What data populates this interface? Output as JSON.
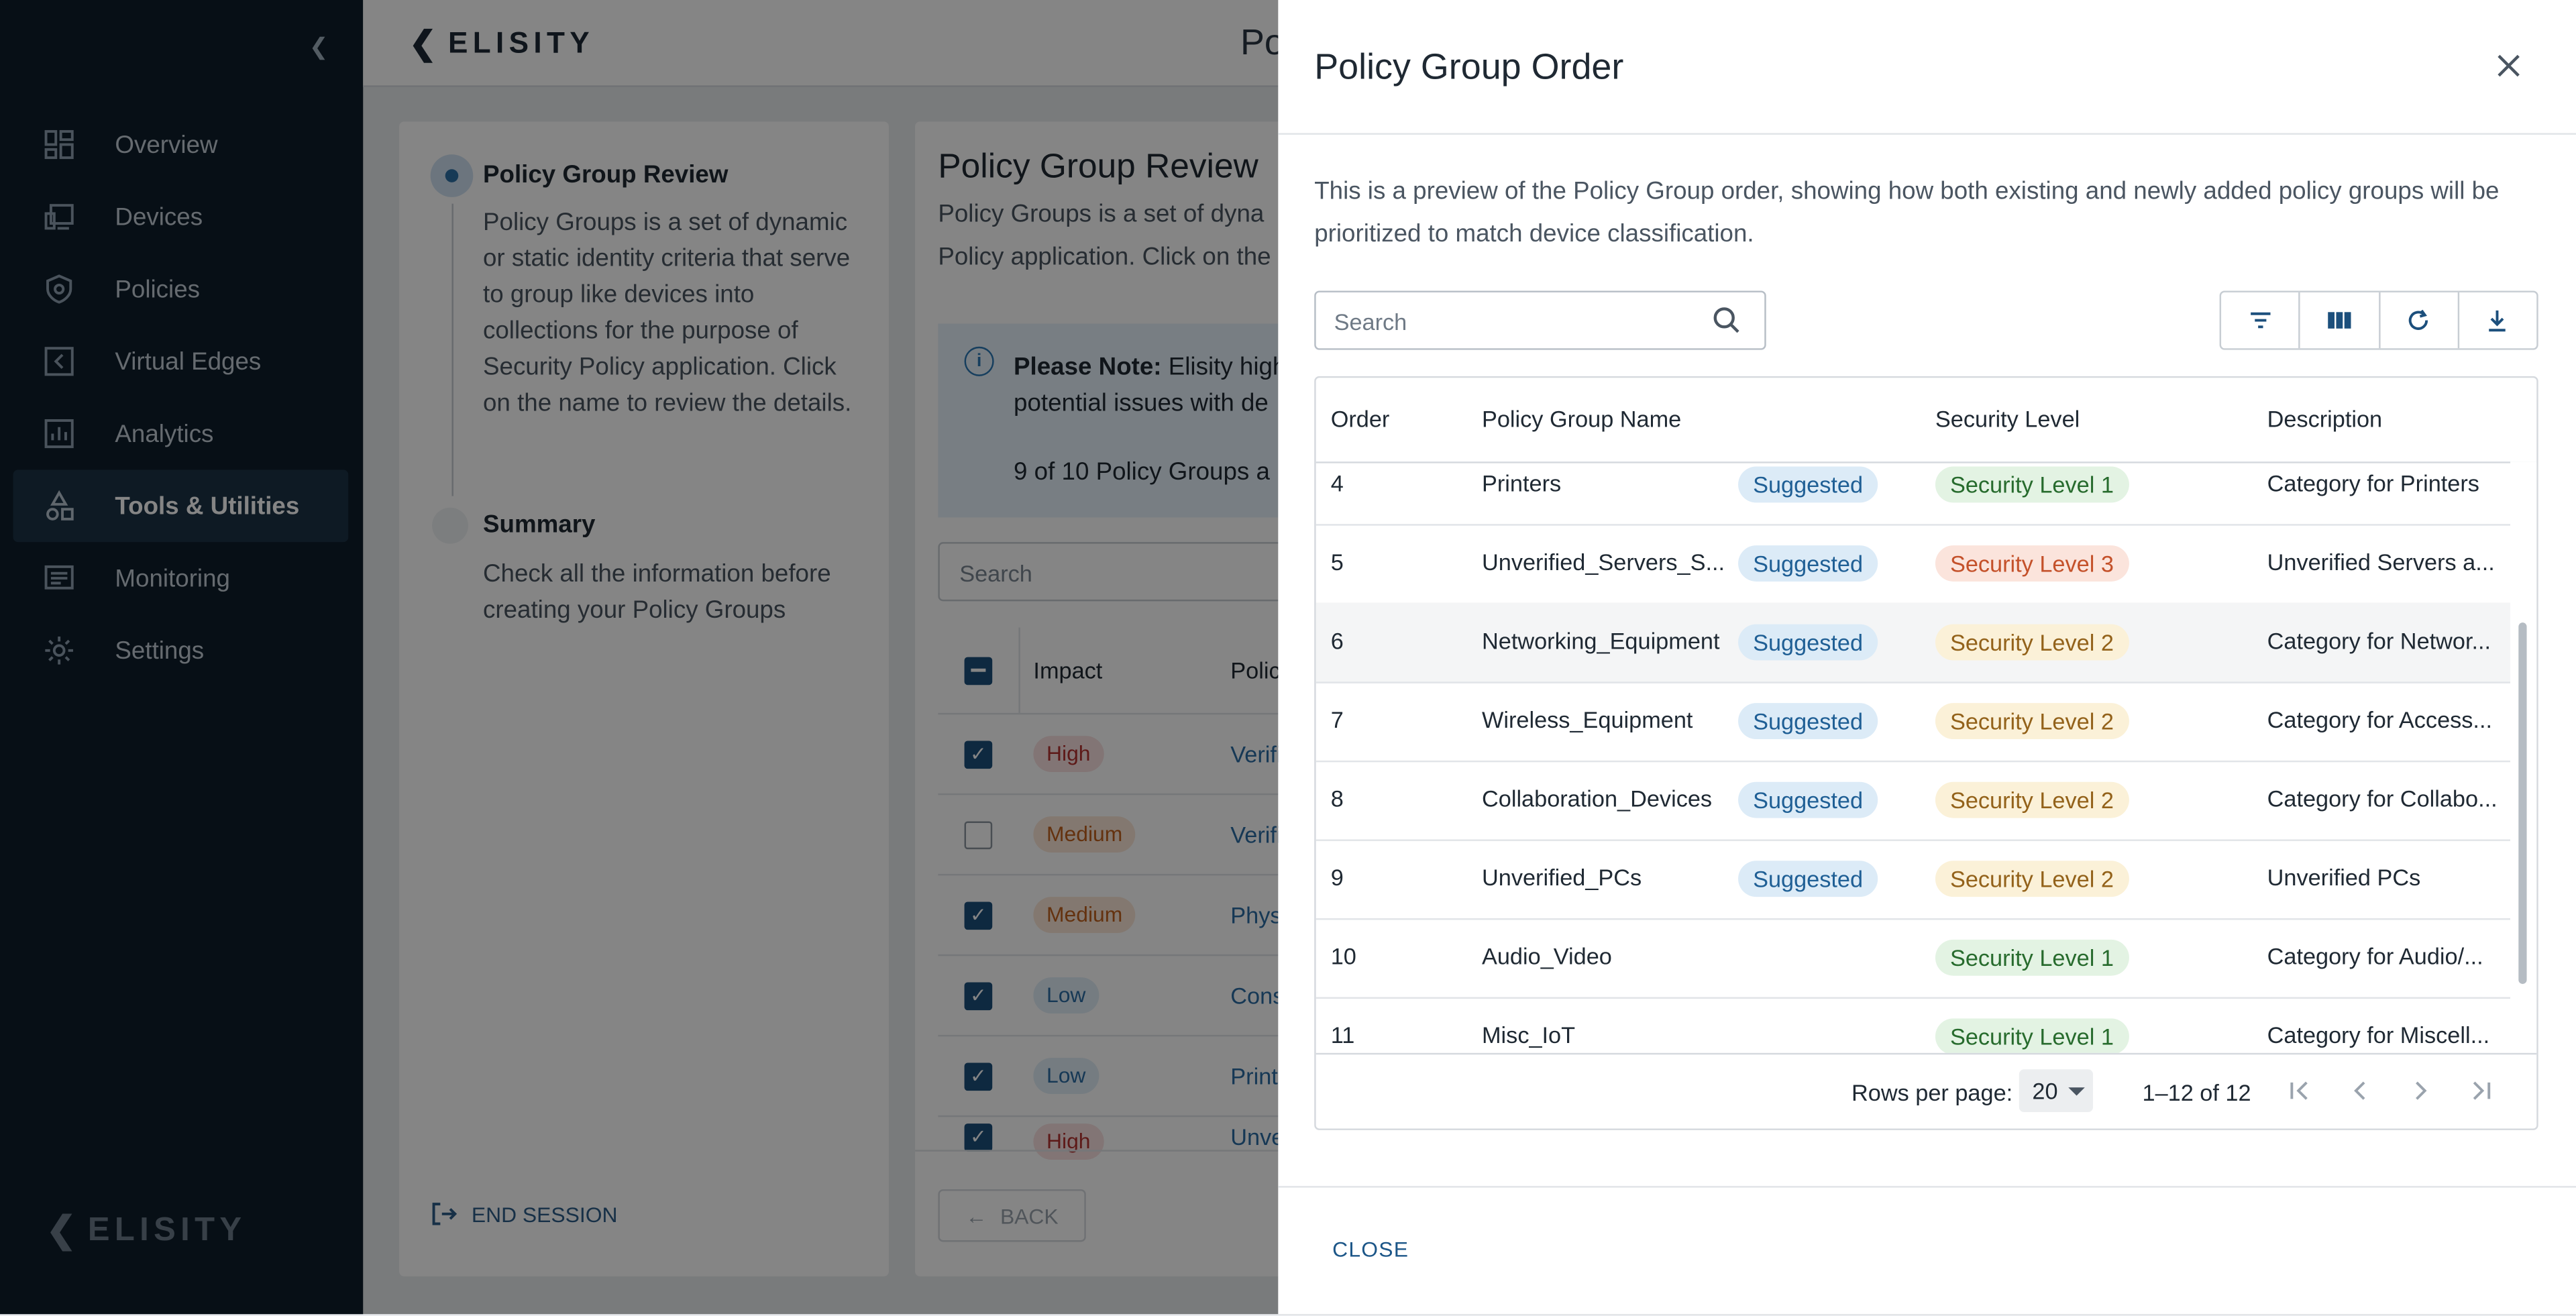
{
  "brand": {
    "name": "ELISITY"
  },
  "sidebar": {
    "items": [
      {
        "label": "Overview",
        "icon": "dashboard-icon"
      },
      {
        "label": "Devices",
        "icon": "devices-icon"
      },
      {
        "label": "Policies",
        "icon": "shield-icon"
      },
      {
        "label": "Virtual Edges",
        "icon": "virtual-edge-icon"
      },
      {
        "label": "Analytics",
        "icon": "analytics-icon"
      },
      {
        "label": "Tools & Utilities",
        "icon": "tools-icon",
        "active": true
      },
      {
        "label": "Monitoring",
        "icon": "monitoring-icon"
      },
      {
        "label": "Settings",
        "icon": "gear-icon"
      }
    ]
  },
  "header": {
    "title": "Po"
  },
  "wizard": {
    "steps": [
      {
        "title": "Policy Group Review",
        "description": "Policy Groups is a set of dynamic or static identity criteria that serve to group like devices into collections for the purpose of Security Policy application. Click on the name to review the details."
      },
      {
        "title": "Summary",
        "description": "Check all the information before creating your Policy Groups"
      }
    ],
    "end_session": "END SESSION"
  },
  "main": {
    "title": "Policy Group Review",
    "description": "Policy Groups is a set of dyna Policy application. Click on the",
    "note": {
      "bold": "Please Note:",
      "text": " Elisity high",
      "text2": "potential issues with de",
      "count": "9 of 10 Policy Groups a"
    },
    "search_placeholder": "Search",
    "table": {
      "headers": [
        "Impact",
        "Polic"
      ],
      "rows": [
        {
          "checked": true,
          "impact": "High",
          "level": "high",
          "name": "Verifi"
        },
        {
          "checked": false,
          "impact": "Medium",
          "level": "medium",
          "name": "Verifi"
        },
        {
          "checked": true,
          "impact": "Medium",
          "level": "medium",
          "name": "Physi"
        },
        {
          "checked": true,
          "impact": "Low",
          "level": "low",
          "name": "Cons"
        },
        {
          "checked": true,
          "impact": "Low",
          "level": "low",
          "name": "Printe"
        },
        {
          "checked": true,
          "impact": "High",
          "level": "high",
          "name": "Unve"
        }
      ]
    },
    "back_label": "BACK"
  },
  "drawer": {
    "title": "Policy Group Order",
    "description": "This is a preview of the Policy Group order, showing how both existing and newly added policy groups will be prioritized to match device classification.",
    "search_placeholder": "Search",
    "columns": [
      "Order",
      "Policy Group Name",
      "Security Level",
      "Description"
    ],
    "rows": [
      {
        "order": "4",
        "name": "Printers",
        "tag": "Suggested",
        "level": "Security Level 1",
        "lvl": 1,
        "description": "Category for Printers"
      },
      {
        "order": "5",
        "name": "Unverified_Servers_S...",
        "tag": "Suggested",
        "level": "Security Level 3",
        "lvl": 3,
        "description": "Unverified Servers a..."
      },
      {
        "order": "6",
        "name": "Networking_Equipment",
        "tag": "Suggested",
        "level": "Security Level 2",
        "lvl": 2,
        "description": "Category for Networ..."
      },
      {
        "order": "7",
        "name": "Wireless_Equipment",
        "tag": "Suggested",
        "level": "Security Level 2",
        "lvl": 2,
        "description": "Category for Access..."
      },
      {
        "order": "8",
        "name": "Collaboration_Devices",
        "tag": "Suggested",
        "level": "Security Level 2",
        "lvl": 2,
        "description": "Category for Collabo..."
      },
      {
        "order": "9",
        "name": "Unverified_PCs",
        "tag": "Suggested",
        "level": "Security Level 2",
        "lvl": 2,
        "description": "Unverified PCs"
      },
      {
        "order": "10",
        "name": "Audio_Video",
        "tag": "",
        "level": "Security Level 1",
        "lvl": 1,
        "description": "Category for Audio/..."
      },
      {
        "order": "11",
        "name": "Misc_IoT",
        "tag": "",
        "level": "Security Level 1",
        "lvl": 1,
        "description": "Category for Miscell..."
      }
    ],
    "pagination": {
      "rows_per_page_label": "Rows per page:",
      "rows_per_page": "20",
      "range": "1–12 of 12"
    },
    "close_label": "CLOSE"
  }
}
